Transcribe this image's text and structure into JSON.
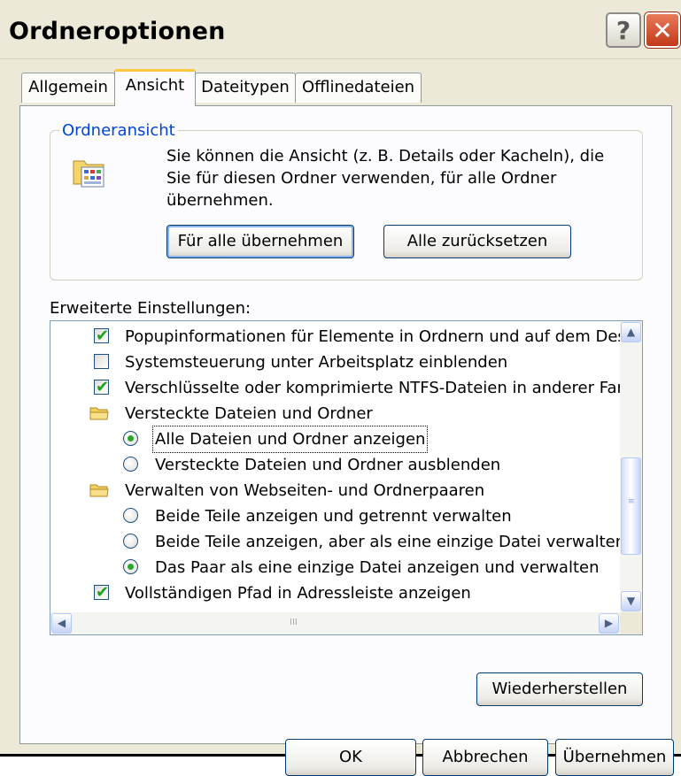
{
  "window": {
    "title": "Ordneroptionen",
    "help_glyph": "?",
    "close_glyph": "✕"
  },
  "tabs": [
    {
      "label": "Allgemein",
      "active": false
    },
    {
      "label": "Ansicht",
      "active": true
    },
    {
      "label": "Dateitypen",
      "active": false
    },
    {
      "label": "Offlinedateien",
      "active": false
    }
  ],
  "folder_view": {
    "legend": "Ordneransicht",
    "text": "Sie können die Ansicht (z. B. Details oder Kacheln), die Sie für diesen Ordner verwenden, für alle Ordner übernehmen.",
    "apply_all_label": "Für alle übernehmen",
    "reset_all_label": "Alle zurücksetzen"
  },
  "advanced": {
    "label": "Erweiterte Einstellungen:",
    "items": [
      {
        "type": "checkbox",
        "checked": true,
        "label": "Popupinformationen für Elemente in Ordnern und auf dem Desktop anzeigen"
      },
      {
        "type": "checkbox",
        "checked": false,
        "label": "Systemsteuerung unter Arbeitsplatz einblenden"
      },
      {
        "type": "checkbox",
        "checked": true,
        "label": "Verschlüsselte oder komprimierte NTFS-Dateien in anderer Farbe anzeigen"
      },
      {
        "type": "folder",
        "label": "Versteckte Dateien und Ordner"
      },
      {
        "type": "radio",
        "checked": true,
        "focused": true,
        "label": "Alle Dateien und Ordner anzeigen"
      },
      {
        "type": "radio",
        "checked": false,
        "label": "Versteckte Dateien und Ordner ausblenden"
      },
      {
        "type": "folder",
        "label": "Verwalten von Webseiten- und Ordnerpaaren"
      },
      {
        "type": "radio",
        "checked": false,
        "label": "Beide Teile anzeigen und getrennt verwalten"
      },
      {
        "type": "radio",
        "checked": false,
        "label": "Beide Teile anzeigen, aber als eine einzige Datei verwalten"
      },
      {
        "type": "radio",
        "checked": true,
        "label": "Das Paar als eine einzige Datei anzeigen und verwalten"
      },
      {
        "type": "checkbox",
        "checked": true,
        "label": "Vollständigen Pfad in Adressleiste anzeigen"
      }
    ],
    "scroll_glyphs": {
      "up": "▲",
      "down": "▼",
      "left": "◀",
      "right": "▶",
      "vgrip": "≡",
      "hgrip": "III"
    }
  },
  "restore_label": "Wiederherstellen",
  "buttons": {
    "ok": "OK",
    "cancel": "Abbrechen",
    "apply": "Übernehmen"
  }
}
